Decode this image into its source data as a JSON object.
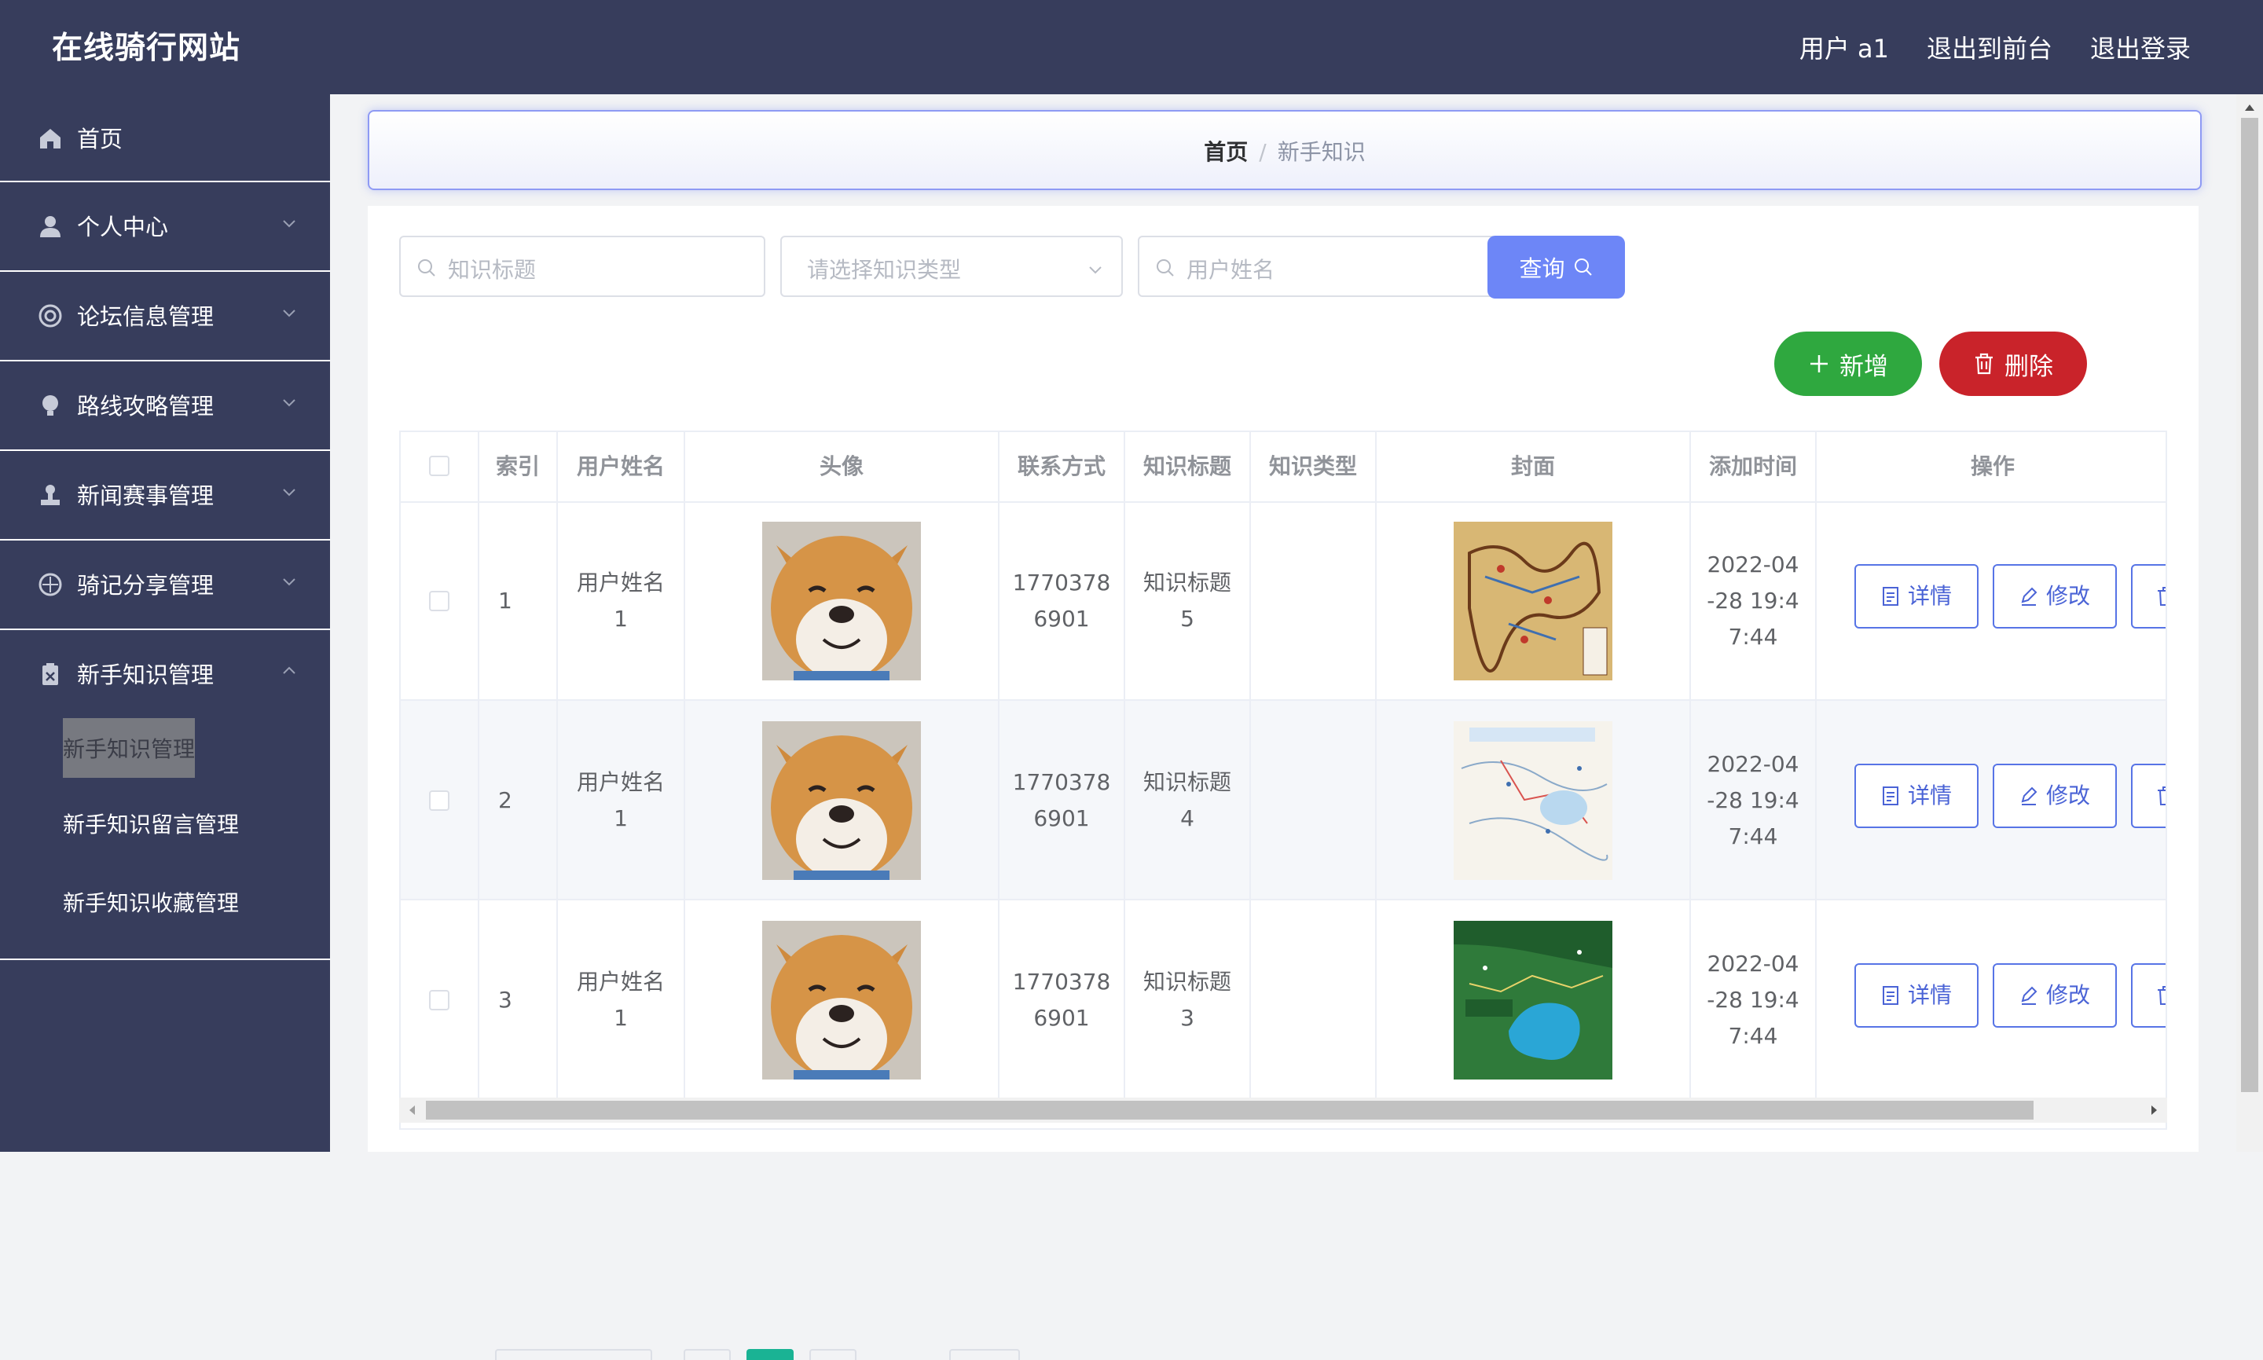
{
  "header": {
    "site_title": "在线骑行网站",
    "user_label": "用户 a1",
    "to_front": "退出到前台",
    "logout": "退出登录"
  },
  "sidebar": {
    "home": "首页",
    "items": [
      {
        "label": "个人中心",
        "icon": "person-icon"
      },
      {
        "label": "论坛信息管理",
        "icon": "lifebuoy-icon"
      },
      {
        "label": "路线攻略管理",
        "icon": "bulb-icon"
      },
      {
        "label": "新闻赛事管理",
        "icon": "stamp-icon"
      },
      {
        "label": "骑记分享管理",
        "icon": "compass-icon"
      },
      {
        "label": "新手知识管理",
        "icon": "clipboard-icon"
      }
    ],
    "sub_items": [
      "新手知识管理",
      "新手知识留言管理",
      "新手知识收藏管理"
    ]
  },
  "breadcrumb": {
    "home": "首页",
    "sep": "/",
    "current": "新手知识"
  },
  "search": {
    "title_placeholder": "知识标题",
    "type_placeholder": "请选择知识类型",
    "user_placeholder": "用户姓名",
    "query_label": "查询"
  },
  "actions": {
    "add_label": "新增",
    "delete_label": "删除"
  },
  "table": {
    "headers": [
      "索引",
      "用户姓名",
      "头像",
      "联系方式",
      "知识标题",
      "知识类型",
      "封面",
      "添加时间",
      "操作"
    ],
    "rows": [
      {
        "index": "1",
        "user_a": "用户姓名",
        "user_b": "1",
        "phone_a": "1770378",
        "phone_b": "6901",
        "title_a": "知识标题",
        "title_b": "5",
        "type": "",
        "time_a": "2022-04",
        "time_b": "-28 19:4",
        "time_c": "7:44"
      },
      {
        "index": "2",
        "user_a": "用户姓名",
        "user_b": "1",
        "phone_a": "1770378",
        "phone_b": "6901",
        "title_a": "知识标题",
        "title_b": "4",
        "type": "",
        "time_a": "2022-04",
        "time_b": "-28 19:4",
        "time_c": "7:44"
      },
      {
        "index": "3",
        "user_a": "用户姓名",
        "user_b": "1",
        "phone_a": "1770378",
        "phone_b": "6901",
        "title_a": "知识标题",
        "title_b": "3",
        "type": "",
        "time_a": "2022-04",
        "time_b": "-28 19:4",
        "time_c": "7:44"
      }
    ],
    "detail_label": "详情",
    "edit_label": "修改"
  },
  "colors": {
    "sidebar_bg": "#373d5c",
    "primary": "#6d86f7",
    "success": "#2fa83f",
    "danger": "#c9232a",
    "link": "#4a63d6"
  }
}
